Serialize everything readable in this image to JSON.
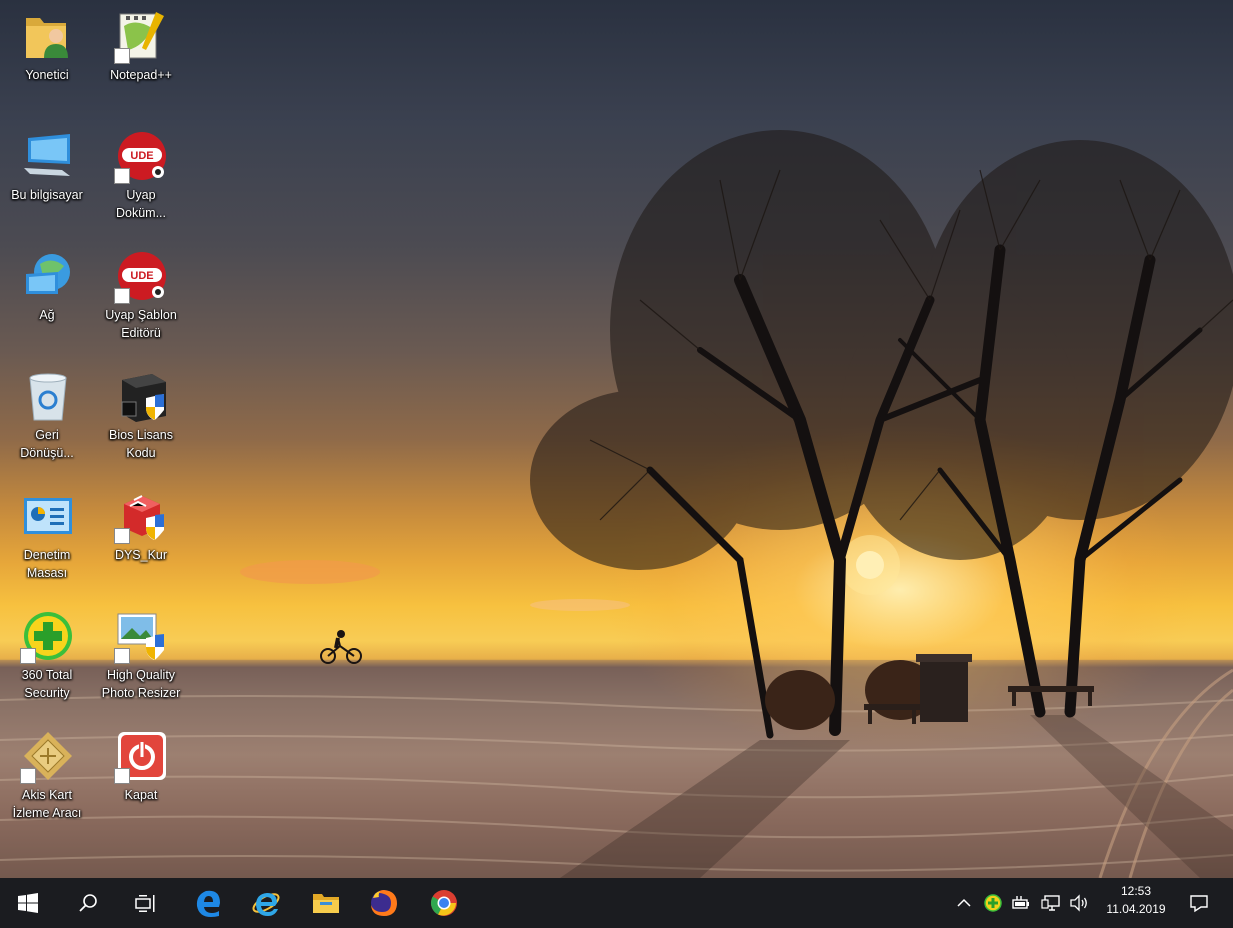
{
  "desktop": {
    "icons": [
      {
        "label": "Yonetici",
        "icon": "user-folder-icon"
      },
      {
        "label": "Notepad++",
        "icon": "notepad-plus-plus-icon"
      },
      {
        "label": "Bu bilgisayar",
        "icon": "computer-icon"
      },
      {
        "label": "Uyap Doküm...",
        "icon": "uyap-document-icon"
      },
      {
        "label": "Ağ",
        "icon": "network-icon"
      },
      {
        "label": "Uyap Şablon Editörü",
        "icon": "uyap-template-editor-icon"
      },
      {
        "label": "Geri Dönüşü...",
        "icon": "recycle-bin-icon"
      },
      {
        "label": "Bios Lisans Kodu",
        "icon": "bios-license-icon"
      },
      {
        "label": "Denetim Masası",
        "icon": "control-panel-icon"
      },
      {
        "label": "DYS_Kur",
        "icon": "dys-setup-icon"
      },
      {
        "label": "360 Total Security",
        "icon": "360-security-icon"
      },
      {
        "label": "High Quality Photo Resizer",
        "icon": "photo-resizer-icon"
      },
      {
        "label": "Akis Kart İzleme Aracı",
        "icon": "smartcard-icon"
      },
      {
        "label": "Kapat",
        "icon": "shutdown-icon"
      }
    ]
  },
  "taskbar": {
    "pinned": [
      "start-icon",
      "search-icon",
      "task-view-icon",
      "edge-icon",
      "internet-explorer-icon",
      "file-explorer-icon",
      "firefox-icon",
      "chrome-icon"
    ],
    "tray": {
      "icons": [
        "chevron-up-icon",
        "360-security-tray-icon",
        "power-tray-icon",
        "network-tray-icon",
        "volume-icon"
      ],
      "time": "12:53",
      "date": "11.04.2019"
    },
    "notification_icon": "action-center-icon"
  }
}
